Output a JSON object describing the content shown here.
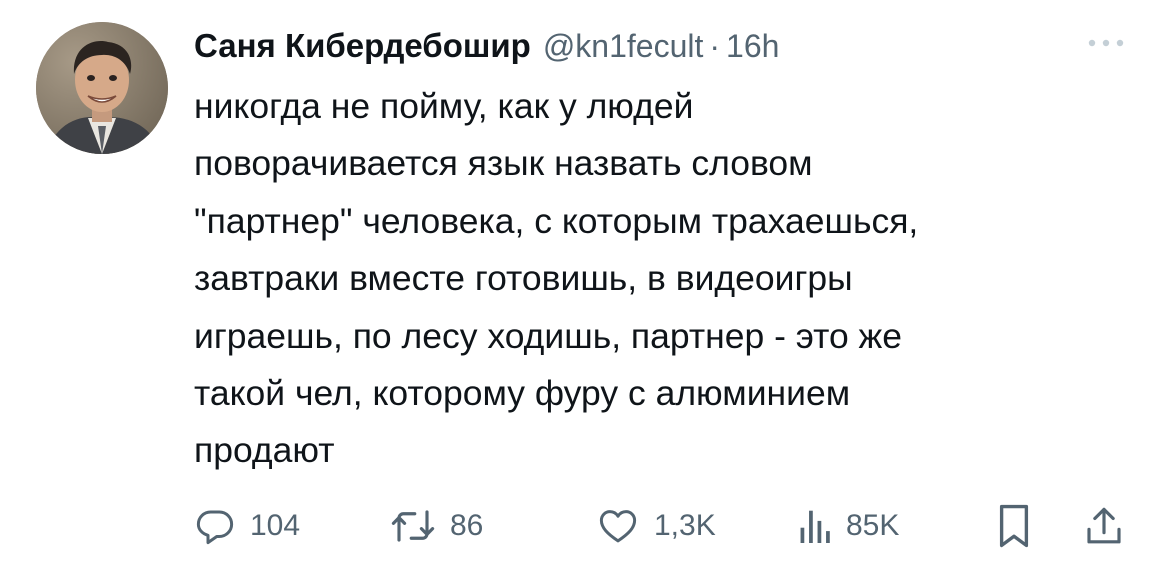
{
  "tweet": {
    "author": {
      "display_name": "Саня Кибердебошир",
      "handle": "@kn1fecult",
      "separator": "·",
      "time": "16h"
    },
    "text": "никогда не пойму, как у людей\nповорачивается язык назвать словом\n\"партнер\" человека, с которым трахаешься,\nзавтраки вместе готовишь, в видеоигры\nиграешь, по лесу ходишь, партнер - это же\nтакой чел, которому фуру с алюминием\nпродают",
    "actions": {
      "reply": {
        "icon": "reply-icon",
        "count": "104"
      },
      "retweet": {
        "icon": "retweet-icon",
        "count": "86"
      },
      "like": {
        "icon": "heart-icon",
        "count": "1,3K"
      },
      "views": {
        "icon": "views-icon",
        "count": "85K"
      },
      "bookmark": {
        "icon": "bookmark-icon"
      },
      "share": {
        "icon": "share-icon"
      }
    }
  },
  "colors": {
    "text": "#0f1419",
    "secondary": "#536471",
    "background": "#ffffff"
  }
}
